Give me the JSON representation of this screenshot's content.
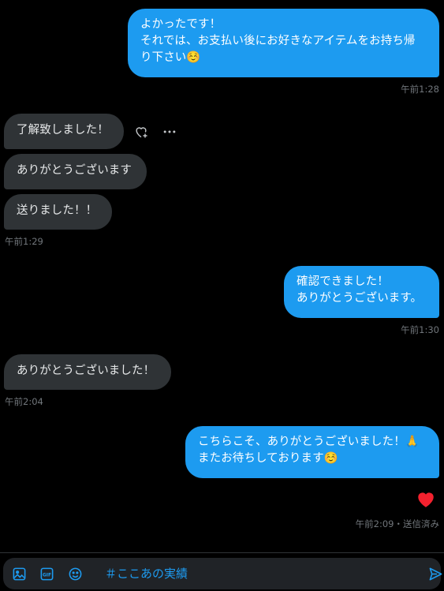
{
  "thread": {
    "messages": [
      {
        "direction": "sent",
        "text": "よかったです！\nそれでは、お支払い後にお好きなアイテムをお持ち帰り下さい☺️"
      },
      {
        "direction": "received",
        "text": "了解致しました！"
      },
      {
        "direction": "received",
        "text": "ありがとうございます"
      },
      {
        "direction": "received",
        "text": "送りました！！"
      },
      {
        "direction": "sent",
        "text": "確認できました！\nありがとうございます。"
      },
      {
        "direction": "received",
        "text": "ありがとうございました！"
      },
      {
        "direction": "sent",
        "text": "こちらこそ、ありがとうございました！🙏\nまたお待ちしております☺️"
      }
    ],
    "timestamps": [
      "午前1:28",
      "午前1:29",
      "午前1:30",
      "午前2:04",
      "午前2:09・送信済み"
    ],
    "reaction": {
      "icon": "heart-icon",
      "color": "#f91880"
    }
  },
  "message_actions": {
    "react_icon": "heart-plus-icon",
    "more_icon": "more-dots-icon"
  },
  "composer": {
    "draft_text": "＃ここあの実績",
    "icons": [
      "image-icon",
      "gif-icon",
      "emoji-icon",
      "send-icon"
    ]
  },
  "colors": {
    "accent": "#1d9bf0",
    "received_bubble": "#2f3336",
    "background": "#000000",
    "muted_text": "#71767b"
  }
}
